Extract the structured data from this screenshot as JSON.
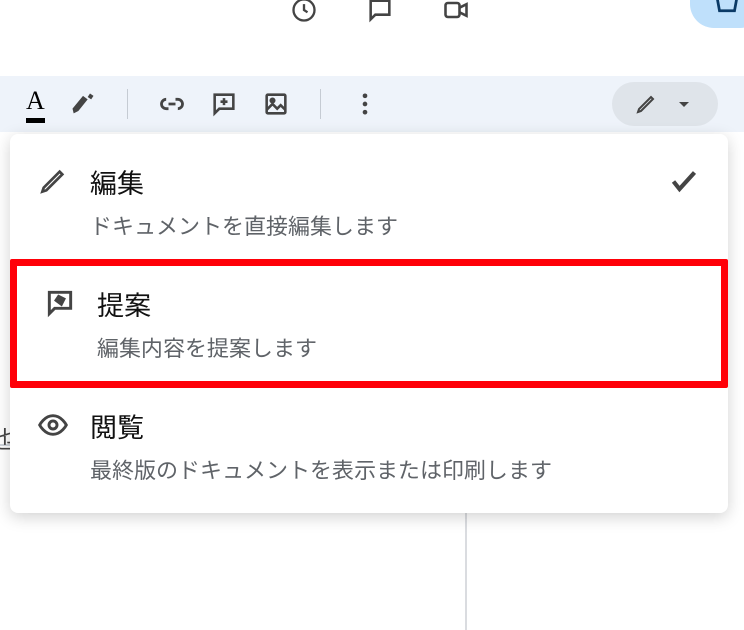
{
  "topIcons": {
    "history": "history-icon",
    "comment": "comment-icon",
    "video": "video-icon",
    "share": "share-icon"
  },
  "toolbar": {
    "textColor": "A",
    "highlight": "marker-icon",
    "link": "link-icon",
    "addComment": "add-comment-icon",
    "image": "image-icon",
    "more": "more-vert-icon"
  },
  "modeButton": {
    "icon": "pencil-icon",
    "caret": "caret-down-icon"
  },
  "dropdown": {
    "items": [
      {
        "title": "編集",
        "desc": "ドキュメントを直接編集します",
        "icon": "pencil-icon",
        "checked": true,
        "highlight": false
      },
      {
        "title": "提案",
        "desc": "編集内容を提案します",
        "icon": "suggest-icon",
        "checked": false,
        "highlight": true
      },
      {
        "title": "閲覧",
        "desc": "最終版のドキュメントを表示または印刷します",
        "icon": "eye-icon",
        "checked": false,
        "highlight": false
      }
    ]
  },
  "partial": "也"
}
